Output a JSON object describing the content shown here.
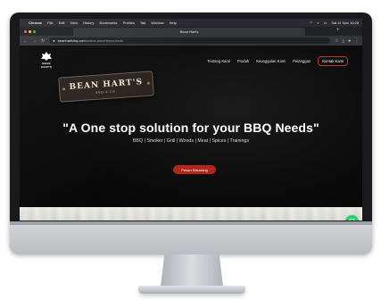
{
  "menubar": {
    "app": "Chrome",
    "items": [
      "File",
      "Edit",
      "View",
      "History",
      "Bookmarks",
      "Profiles",
      "Tab",
      "Window",
      "Help"
    ],
    "clock": "Sat 11 Nov 10:28"
  },
  "browser": {
    "tab_title": "Bean Hart's",
    "new_tab_glyph": "+",
    "url_host": "beanhartbbq.com",
    "url_path": "/online-store/bean-harts"
  },
  "site": {
    "logo_word": "BEAN HART'S",
    "nav": [
      "Tentang Kami",
      "Produk",
      "Keunggulan Kami",
      "Pelanggan"
    ],
    "cta": "Kontak Kami",
    "sign_big": "BEAN HART'S",
    "sign_small": "BBQ & CO.",
    "headline": "\"A One stop solution for your BBQ Needs\"",
    "subline": "BBQ | Smoker | Grill | Woods | Meat | Spices | Trainings",
    "order_button": "Pesan Sekarang"
  },
  "colors": {
    "accent": "#b3261e",
    "whatsapp": "#25d366",
    "menubar": "#2a2a33",
    "browser_chrome": "#35363a"
  },
  "icons": {
    "whatsapp": "whatsapp-icon",
    "apple": "apple-icon",
    "back": "back-arrow-icon",
    "forward": "forward-arrow-icon",
    "reload": "reload-icon",
    "lock": "lock-icon"
  }
}
